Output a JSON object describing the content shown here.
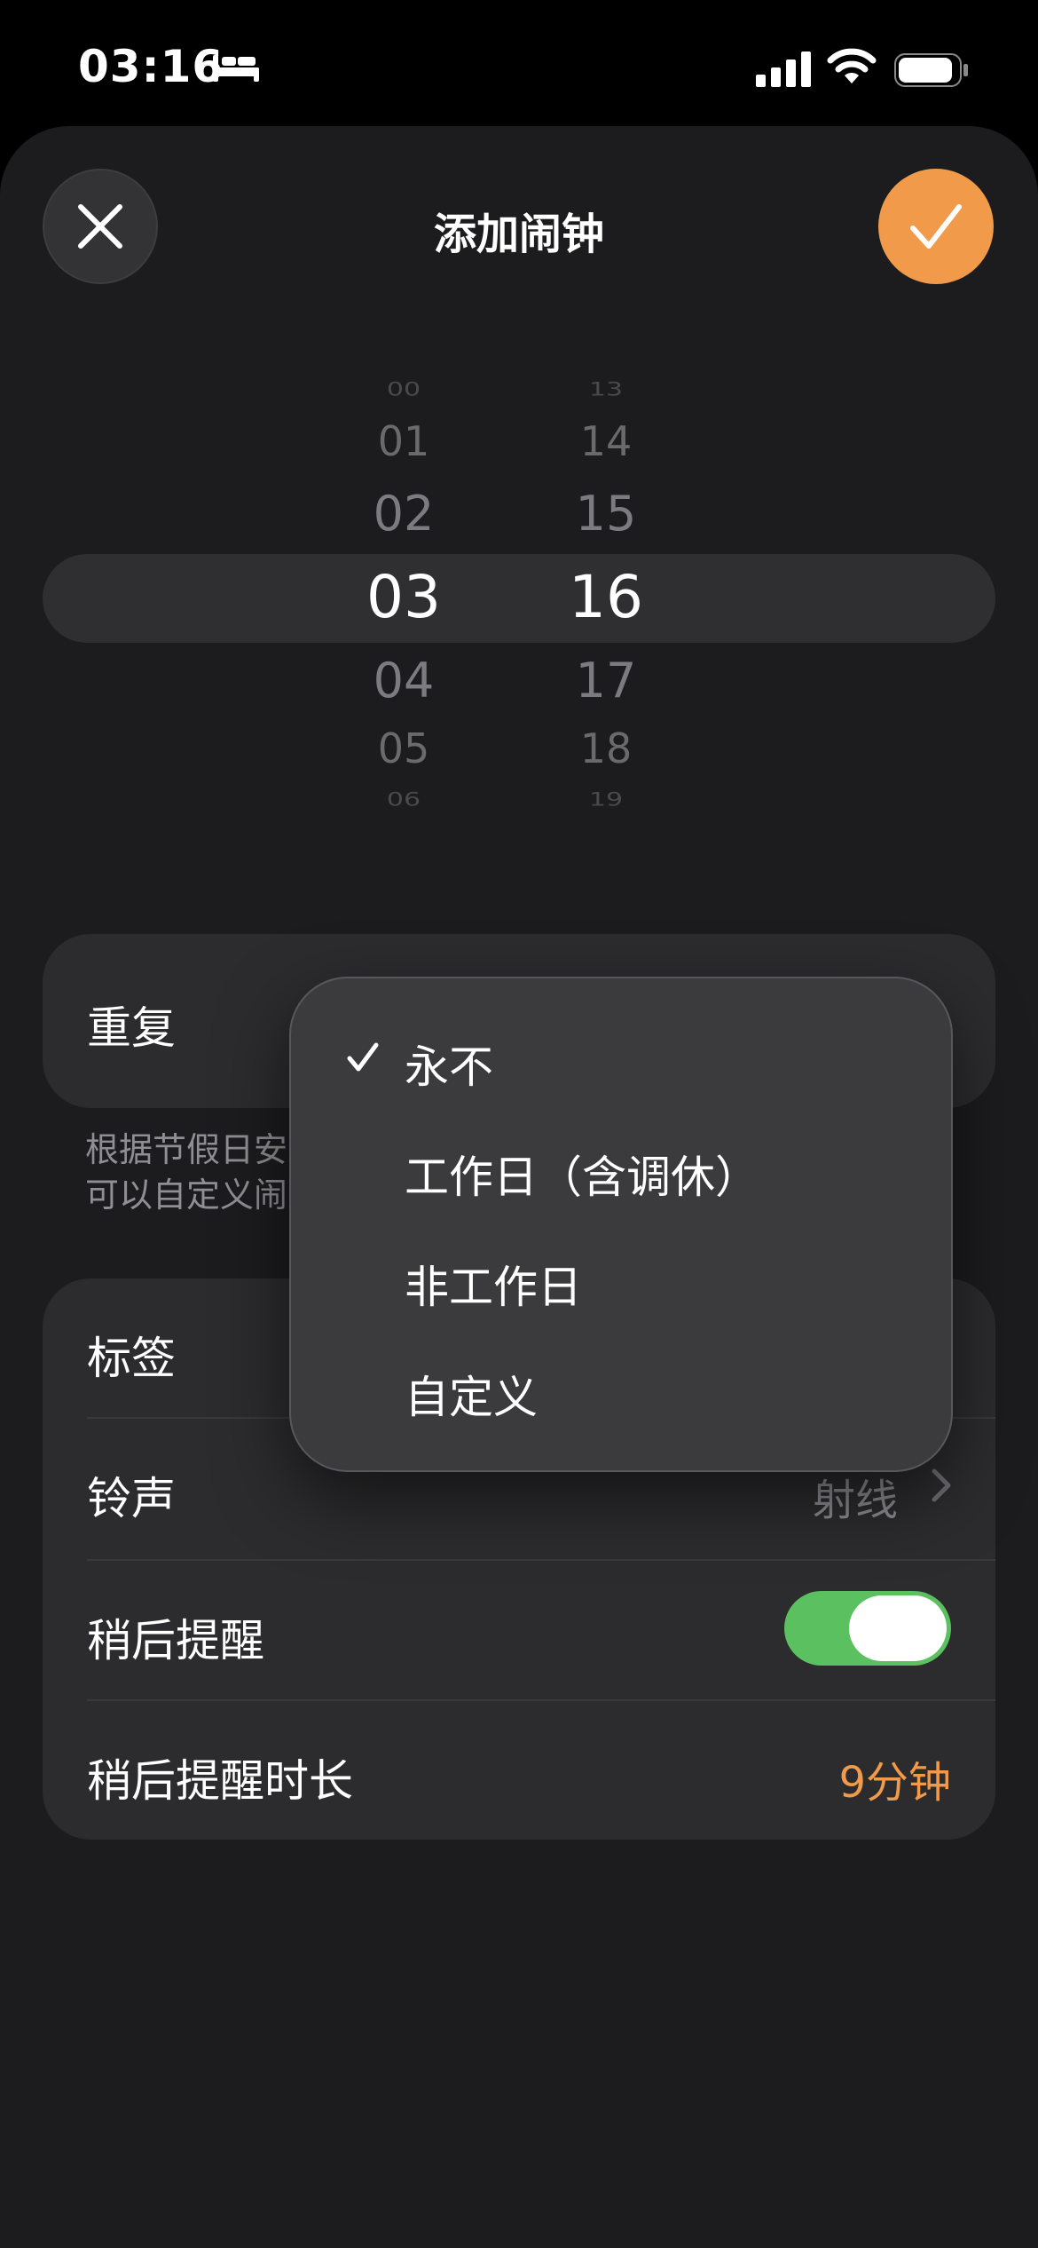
{
  "status_bar": {
    "time": "03:16",
    "icons": [
      "bed-icon",
      "signal-icon",
      "wifi-icon",
      "battery-icon"
    ]
  },
  "header": {
    "title": "添加闹钟",
    "close_icon": "close-icon",
    "confirm_icon": "checkmark-icon"
  },
  "picker": {
    "hours": [
      "00",
      "01",
      "02",
      "03",
      "04",
      "05",
      "06"
    ],
    "minutes": [
      "13",
      "14",
      "15",
      "16",
      "17",
      "18",
      "19"
    ],
    "selected_hour": "03",
    "selected_minute": "16"
  },
  "repeat": {
    "label": "重复",
    "footnote_line1": "根据节假日安",
    "footnote_line2": "可以自定义闹"
  },
  "options": {
    "label_row": {
      "label": "标签"
    },
    "ringtone_row": {
      "label": "铃声",
      "value": "射线"
    },
    "snooze_row": {
      "label": "稍后提醒",
      "enabled": true
    },
    "snooze_duration_row": {
      "label": "稍后提醒时长",
      "value": "9分钟"
    }
  },
  "repeat_menu": {
    "items": [
      {
        "label": "永不",
        "selected": true
      },
      {
        "label": "工作日（含调休）",
        "selected": false
      },
      {
        "label": "非工作日",
        "selected": false
      },
      {
        "label": "自定义",
        "selected": false
      }
    ]
  },
  "colors": {
    "accent": "#f09a4a",
    "toggle_on": "#5bc05f",
    "background": "#1c1c1e",
    "card": "#2c2c2e"
  }
}
